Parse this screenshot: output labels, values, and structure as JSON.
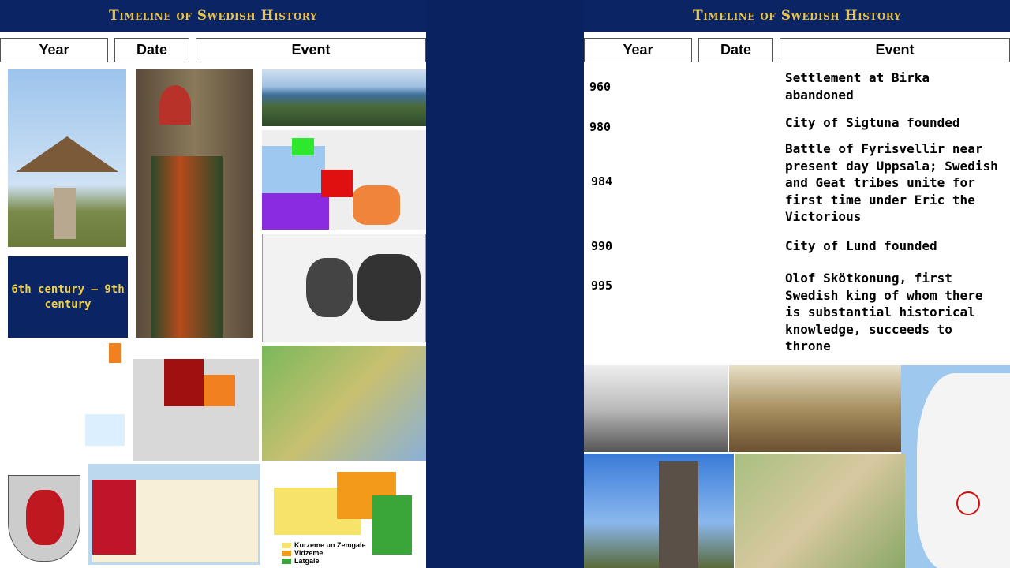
{
  "slide_title": "Timeline of Swedish History",
  "headers": {
    "year": "Year",
    "date": "Date",
    "event": "Event"
  },
  "left": {
    "century_label": "6th century – 9th century",
    "latvia_legend": [
      "Kurzeme un Zemgale",
      "Vidzeme",
      "Latgale"
    ],
    "latvia_colors": [
      "#f7e36a",
      "#f39a1a",
      "#3aa63a"
    ]
  },
  "right": {
    "rows": [
      {
        "year": "960",
        "event": "Settlement at Birka abandoned"
      },
      {
        "year": "980",
        "event": "City of Sigtuna founded"
      },
      {
        "year": "984",
        "event": "Battle of Fyrisvellir near present day Uppsala; Swedish and Geat tribes unite for first time under Eric the Victorious"
      },
      {
        "year": "990",
        "event": "City of Lund founded"
      },
      {
        "year": "995",
        "event": "Olof Skötkonung, first Swedish king of whom there is substantial historical knowledge, succeeds to throne"
      }
    ]
  },
  "colors": {
    "navy": "#0b2463",
    "gold": "#e8c247"
  }
}
